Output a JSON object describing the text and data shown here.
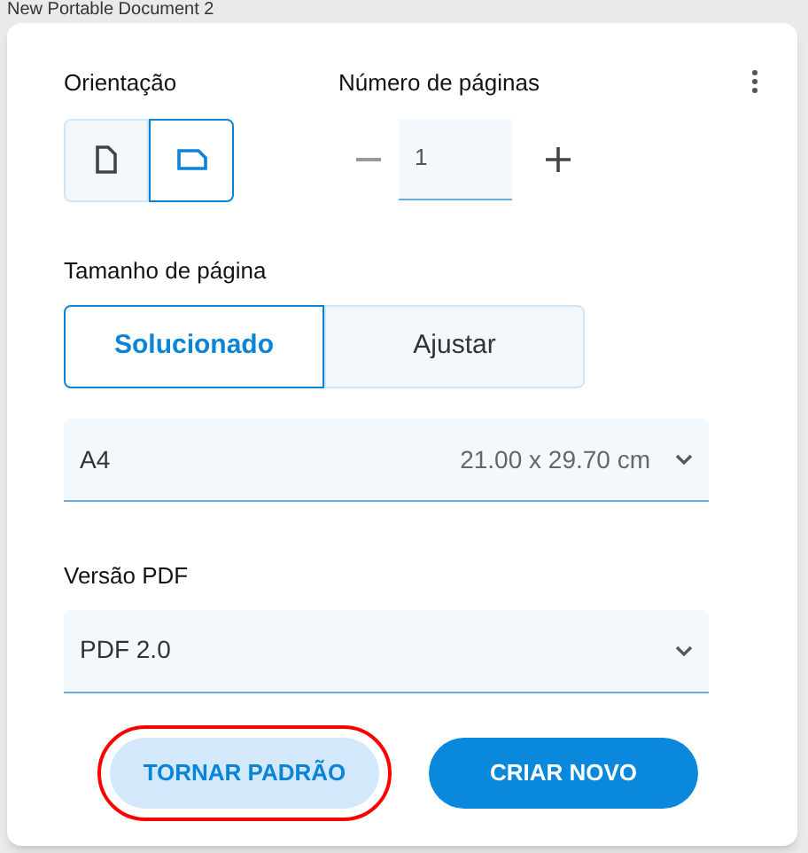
{
  "background_title": "New Portable Document 2",
  "orientation": {
    "label": "Orientação",
    "options": [
      {
        "kind": "portrait",
        "selected": false
      },
      {
        "kind": "landscape",
        "selected": true
      }
    ]
  },
  "pages": {
    "label": "Número de páginas",
    "value": "1"
  },
  "page_size": {
    "label": "Tamanho de página",
    "modes": [
      {
        "label": "Solucionado",
        "selected": true
      },
      {
        "label": "Ajustar",
        "selected": false
      }
    ],
    "select": {
      "value": "A4",
      "detail": "21.00 x 29.70 cm"
    }
  },
  "pdf_version": {
    "label": "Versão PDF",
    "select": {
      "value": "PDF 2.0"
    }
  },
  "buttons": [
    {
      "label": "TORNAR PADRÃO",
      "kind": "secondary",
      "highlighted": true
    },
    {
      "label": "CRIAR NOVO",
      "kind": "primary",
      "highlighted": false
    }
  ]
}
